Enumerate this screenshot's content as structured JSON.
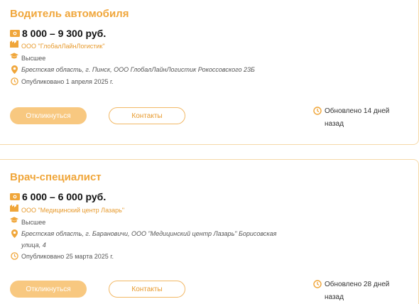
{
  "colors": {
    "accent": "#f0a63a",
    "button_primary": "#f8c880",
    "border": "#f6d9a8"
  },
  "vacancies": [
    {
      "title": "Водитель автомобиля",
      "salary": "8 000 – 9 300 руб.",
      "company": "ООО \"ГлобалЛайнЛогистик\"",
      "education": "Высшее",
      "address": "Брестская область, г. Пинск, ООО ГлобалЛайнЛогистик Рокоссовского 23Б",
      "published": "Опубликовано 1 апреля 2025 г.",
      "respond_label": "Откликнуться",
      "contacts_label": "Контакты",
      "updated": "Обновлено 14 дней назад"
    },
    {
      "title": "Врач-специалист",
      "salary": "6 000 – 6 000 руб.",
      "company": "ООО \"Медицинский центр Лазарь\"",
      "education": "Высшее",
      "address": "Брестская область, г. Барановичи, ООО \"Медицинский центр Лазарь\" Борисовская улица, 4",
      "published": "Опубликовано 25 марта 2025 г.",
      "respond_label": "Откликнуться",
      "contacts_label": "Контакты",
      "updated": "Обновлено 28 дней назад"
    }
  ],
  "icons": [
    "money-icon",
    "company-icon",
    "education-icon",
    "location-icon",
    "clock-icon"
  ]
}
